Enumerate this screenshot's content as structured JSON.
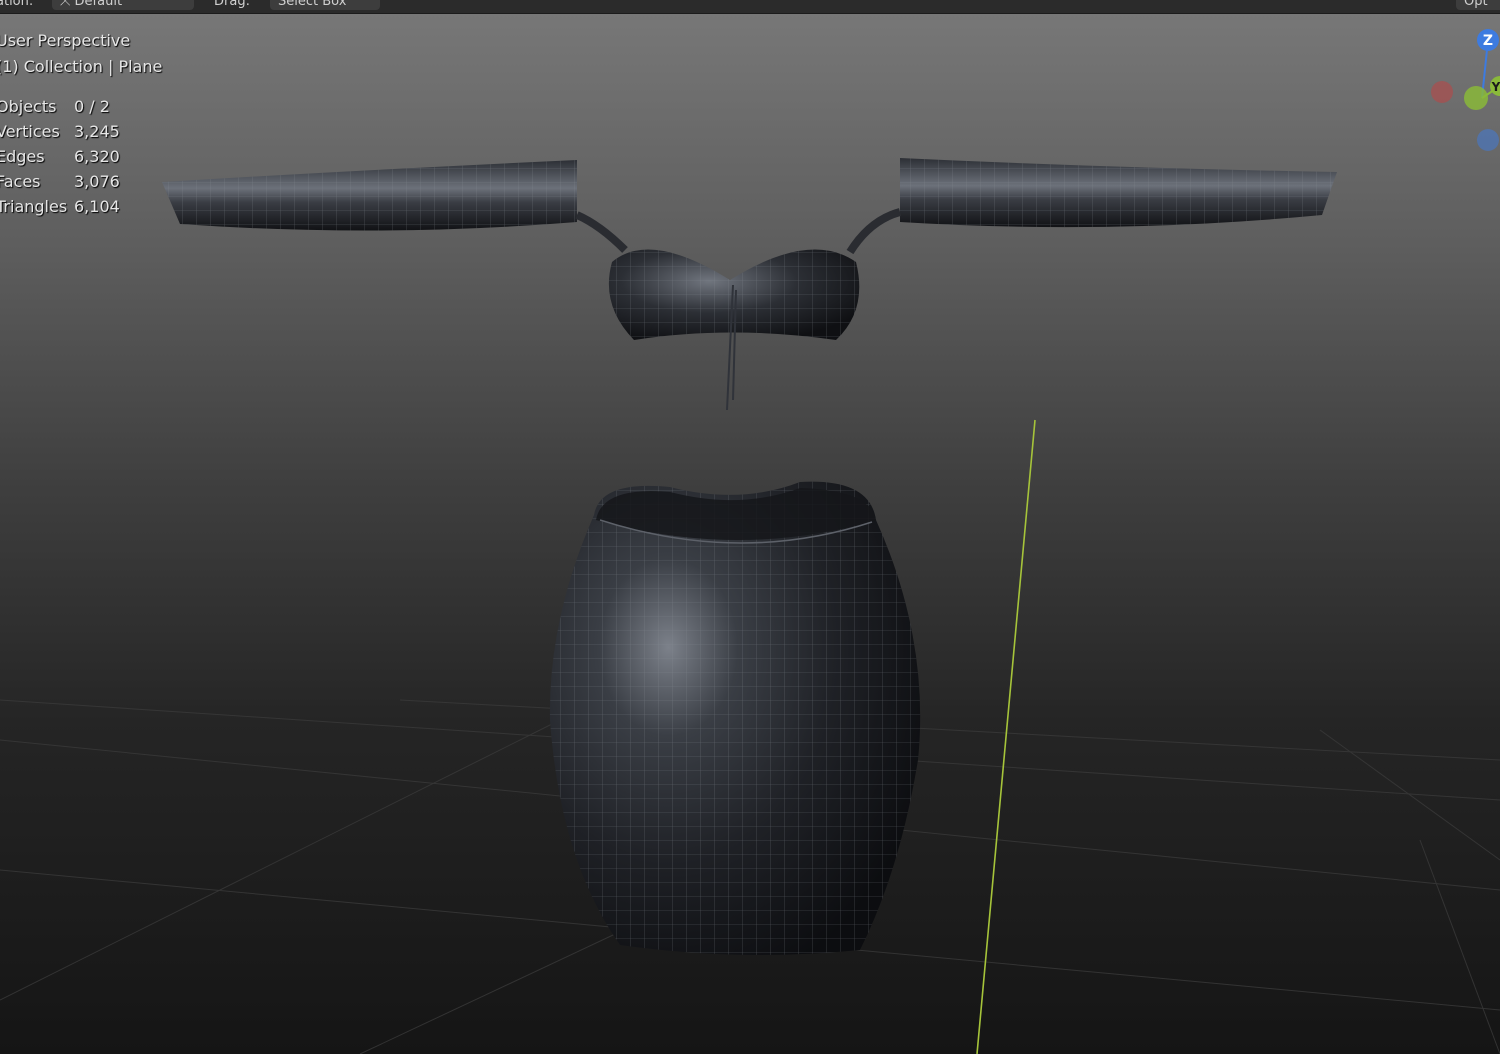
{
  "topbar": {
    "orientation_label": "ation:",
    "orientation_value": "Default",
    "drag_label": "Drag:",
    "drag_value": "Select Box",
    "options_label": "Opt"
  },
  "viewport": {
    "view_name": "User Perspective",
    "collection_path": "(1) Collection | Plane",
    "stats": [
      {
        "label": "Objects",
        "value": "0 / 2"
      },
      {
        "label": "Vertices",
        "value": "3,245"
      },
      {
        "label": "Edges",
        "value": "6,320"
      },
      {
        "label": "Faces",
        "value": "3,076"
      },
      {
        "label": "Triangles",
        "value": "6,104"
      }
    ]
  },
  "gizmo": {
    "z_label": "Z",
    "y_label": "Y",
    "colors": {
      "x": "#c6403f",
      "y": "#8ab93a",
      "z": "#3d7be0"
    }
  },
  "scene": {
    "material_color": "#1c1e22",
    "wire_color": "#8a8f96",
    "z_axis_color": "#a6c43a"
  }
}
